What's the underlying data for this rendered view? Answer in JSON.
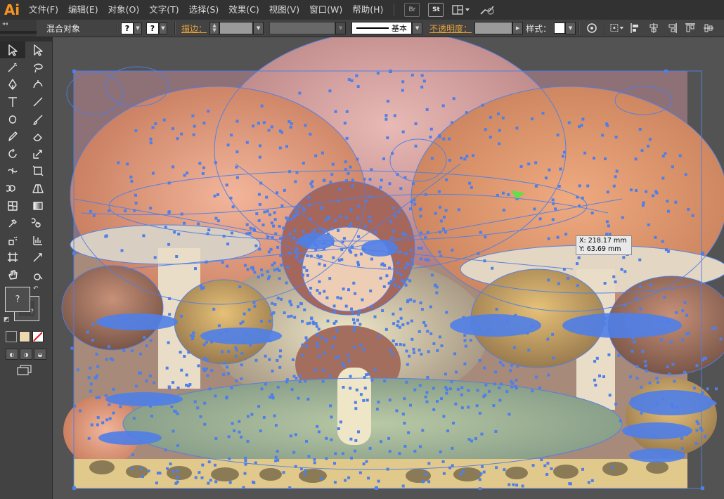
{
  "app": {
    "logo": "Ai"
  },
  "menu": {
    "items": [
      "文件(F)",
      "编辑(E)",
      "对象(O)",
      "文字(T)",
      "选择(S)",
      "效果(C)",
      "视图(V)",
      "窗口(W)",
      "帮助(H)"
    ],
    "bridge_label": "Br",
    "stock_label": "St"
  },
  "control_bar": {
    "selection_label": "混合对象",
    "fill_value": "?",
    "stroke_value": "?",
    "stroke_label": "描边",
    "stroke_profile": "基本",
    "opacity_label": "不透明度",
    "style_label": "样式"
  },
  "toolbar": {
    "fill_indicator": "?",
    "stroke_indicator": "?"
  },
  "canvas": {
    "coord_x": "X: 218.17 mm",
    "coord_y": "Y: 63.69 mm",
    "selection_color": "#4f7fe8"
  },
  "colors": {
    "menubar_bg": "#323232",
    "panel_bg": "#434343",
    "canvas_bg": "#535353",
    "accent_orange": "#f79421"
  }
}
